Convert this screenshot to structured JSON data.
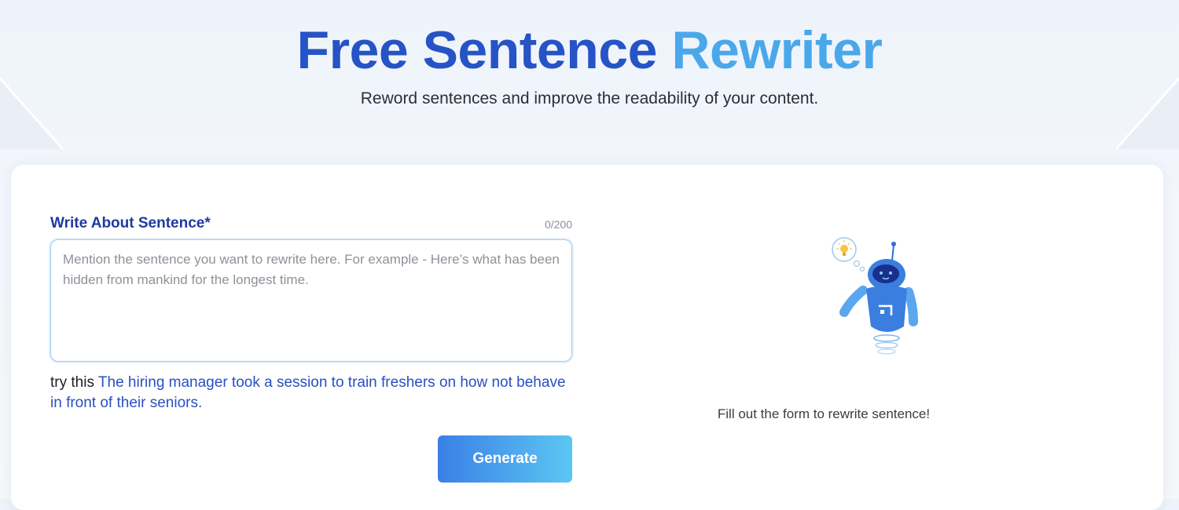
{
  "hero": {
    "title_part1": "Free Sentence",
    "title_part2": "Rewriter",
    "subtitle": "Reword sentences and improve the readability of your content."
  },
  "form": {
    "label": "Write About Sentence*",
    "char_count": "0/200",
    "placeholder": "Mention the sentence you want to rewrite here. For example - Here’s what has been hidden from mankind for the longest time.",
    "value": "",
    "try_prefix": "try this",
    "try_example": "The hiring manager took a session to train freshers on how not behave in front of their seniors.",
    "generate_label": "Generate"
  },
  "result": {
    "illustration": "robot-icon",
    "empty_message": "Fill out the form to rewrite sentence!"
  },
  "colors": {
    "title_dark": "#2653c5",
    "title_light": "#4aa8ea",
    "label": "#1f3a9e",
    "link": "#2a4fc2",
    "button_start": "#3a80e6",
    "button_end": "#5cc6f2"
  }
}
